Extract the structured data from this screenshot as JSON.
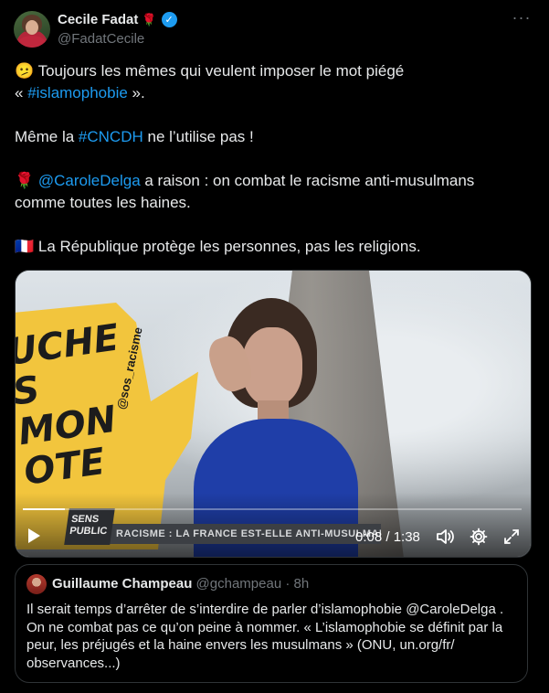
{
  "author": {
    "display_name": "Cecile Fadat",
    "name_emoji": "🌹",
    "handle": "@FadatCecile",
    "verified": true
  },
  "more_icon": "more-horizontal-icon",
  "tweet": {
    "line1_emoji": "🫤",
    "line1_a": " Toujours les mêmes qui veulent imposer le mot piégé",
    "line1_b_open": "« ",
    "line1_b_link": "#islamophobie",
    "line1_b_close": " ».",
    "line2_a": "Même la ",
    "line2_link": "#CNCDH",
    "line2_b": " ne l’utilise pas !",
    "line3_emoji": "🌹",
    "line3_mention": " @CaroleDelga",
    "line3_b": " a raison : on combat le racisme anti-musulmans",
    "line3_c": "comme toutes les haines.",
    "line4_emoji": "🇫🇷",
    "line4_text": " La République protège les personnes, pas les religions."
  },
  "video": {
    "sign_text": "UCHE\nS\nMON\nOTE",
    "sign_handle": "@sos_racisme",
    "logo_text": "SENS\nPUBLIC",
    "banner_text": "RACISME : LA FRANCE EST-ELLE ANTI-MUSULMANE",
    "time": "0:08 / 1:38",
    "progress_fraction": 0.085,
    "icons": [
      "play-icon",
      "volume-icon",
      "settings-icon",
      "fullscreen-icon"
    ]
  },
  "quote": {
    "name": "Guillaume Champeau",
    "handle": "@gchampeau",
    "separator": " · ",
    "age": "8h",
    "text_line1": "Il serait temps d’arrêter de s’interdire de parler d’islamophobie @CaroleDelga .",
    "text_line2": "On ne combat pas ce qu’on peine à nommer. « L’islamophobie se définit par la",
    "text_line3": "peur, les préjugés et la haine envers les musulmans » (ONU, un.org/fr/",
    "text_line4": "observances...)"
  },
  "colors": {
    "background": "#000000",
    "text": "#e7e9ea",
    "muted": "#71767b",
    "link": "#1d9bf0",
    "border": "#2f3336"
  }
}
